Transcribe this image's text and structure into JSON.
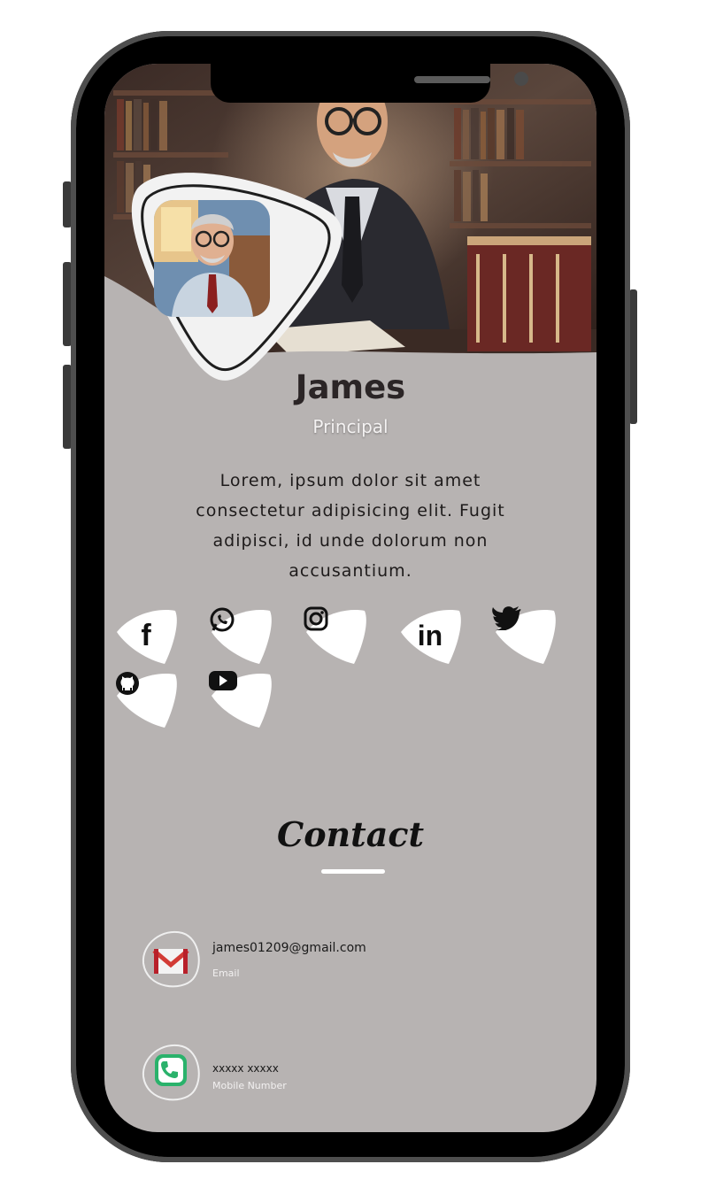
{
  "profile": {
    "name": "James",
    "role": "Principal",
    "bio": "Lorem, ipsum dolor sit amet consectetur adipisicing elit. Fugit adipisci, id unde dolorum non accusantium."
  },
  "social": [
    {
      "icon": "facebook-icon",
      "glyph": "f"
    },
    {
      "icon": "whatsapp-icon",
      "glyph": ""
    },
    {
      "icon": "instagram-icon",
      "glyph": ""
    },
    {
      "icon": "linkedin-icon",
      "glyph": "in"
    },
    {
      "icon": "twitter-icon",
      "glyph": ""
    },
    {
      "icon": "github-icon",
      "glyph": ""
    },
    {
      "icon": "youtube-icon",
      "glyph": ""
    }
  ],
  "contact": {
    "title": "Contact",
    "email": {
      "value": "james01209@gmail.com",
      "label": "Email",
      "icon": "gmail-icon"
    },
    "phone": {
      "value": "xxxxx xxxxx",
      "label": "Mobile Number",
      "icon": "phone-icon"
    }
  },
  "colors": {
    "background": "#b7b3b2",
    "accent": "#ffffff",
    "text": "#2b2526"
  }
}
